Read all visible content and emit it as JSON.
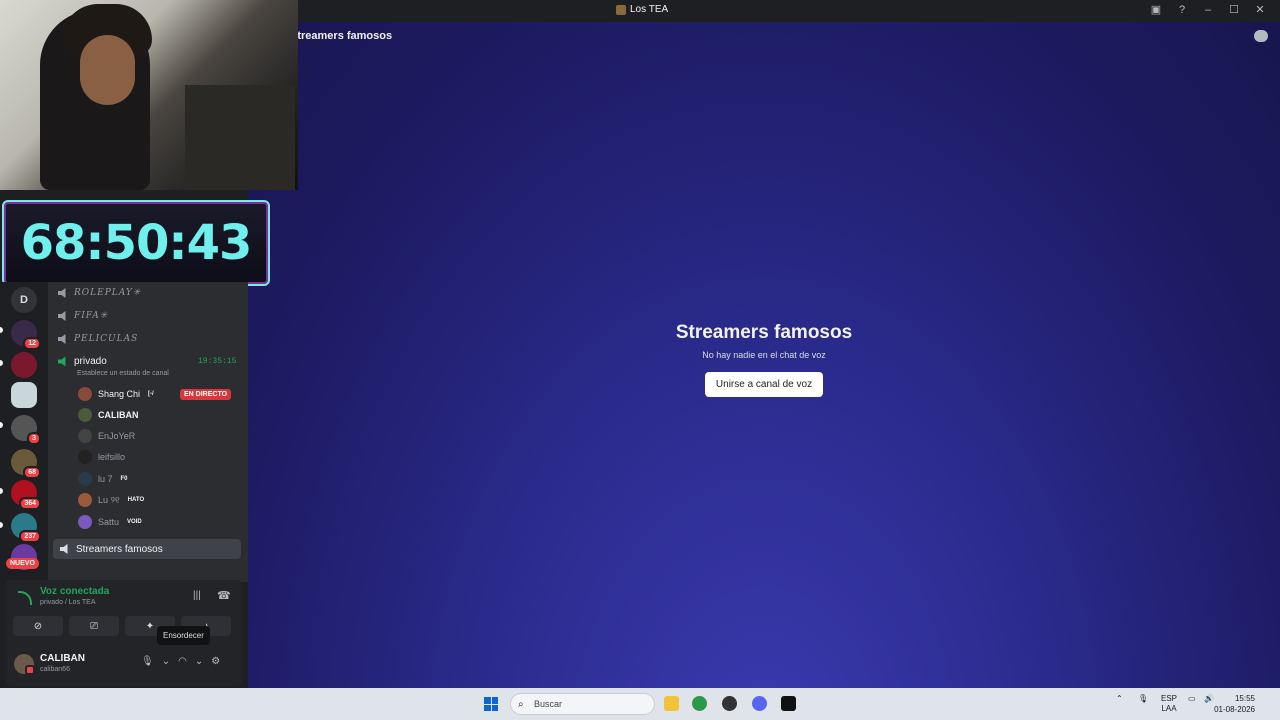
{
  "window": {
    "title": "Los TEA",
    "controls": [
      "inbox-icon",
      "help-icon",
      "minimize-icon",
      "maximize-icon",
      "close-icon"
    ]
  },
  "header": {
    "channel": "Streamers famosos"
  },
  "stage": {
    "title": "Streamers famosos",
    "subtitle": "No hay nadie en el chat de voz",
    "join_label": "Unirse a canal de voz"
  },
  "overlay": {
    "timer": "68:50:43"
  },
  "guilds": [
    {
      "letter": "D"
    },
    {
      "badge": "12"
    },
    {
      "badge": ""
    },
    {
      "badge": ""
    },
    {
      "badge": "3"
    },
    {
      "badge": "68"
    },
    {
      "badge": "364"
    },
    {
      "badge": "237"
    },
    {
      "label": "NUEVO"
    }
  ],
  "channels": {
    "roleplay": "ROLEPLAY✳",
    "fifa": "FIFA✳",
    "peliculas": "PELICULAS",
    "privado": {
      "name": "privado",
      "time": "19:35:15",
      "status": "Establece un estado de canal"
    },
    "members": [
      {
        "name": "Shang Chi",
        "tag": "[-/",
        "live": "EN DIRECTO"
      },
      {
        "name": "CALIBAN"
      },
      {
        "name": "EnJoYeR"
      },
      {
        "name": "leifsillo"
      },
      {
        "name": "lu 7",
        "tag": "F0"
      },
      {
        "name": "Lu ୨୧",
        "tag": "HATO"
      },
      {
        "name": "Sattu",
        "tag": "VOID"
      }
    ],
    "selected": "Streamers famosos"
  },
  "voice": {
    "status": "Voz conectada",
    "location": "privado / Los TEA",
    "tooltip": "Ensordecer"
  },
  "user": {
    "name": "CALIBAN",
    "handle": "caliban66"
  },
  "taskbar": {
    "search": "Buscar",
    "lang": "ESP",
    "region": "LAA",
    "time": "15:55",
    "date": "01-08-2026"
  },
  "colors": {
    "online": "#23a55a",
    "live": "#da373c",
    "accent": "#5865f2"
  }
}
